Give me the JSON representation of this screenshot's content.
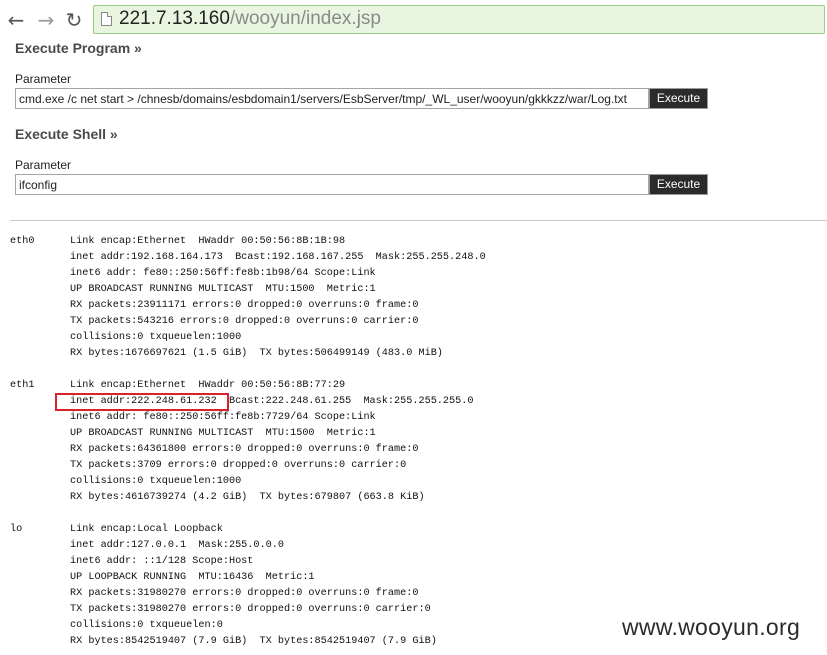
{
  "browser": {
    "back_icon": "←",
    "forward_icon": "→",
    "reload_icon": "↻",
    "url_host": "221.7.13.160",
    "url_path": "/wooyun/index.jsp"
  },
  "execute_program": {
    "title": "Execute Program »",
    "param_label": "Parameter",
    "value": "cmd.exe /c net start > /chnesb/domains/esbdomain1/servers/EsbServer/tmp/_WL_user/wooyun/gkkkzz/war/Log.txt",
    "button_label": "Execute"
  },
  "execute_shell": {
    "title": "Execute Shell »",
    "param_label": "Parameter",
    "value": "ifconfig",
    "button_label": "Execute"
  },
  "output": {
    "interfaces": [
      {
        "name": "eth0",
        "lines": [
          "Link encap:Ethernet  HWaddr 00:50:56:8B:1B:98",
          "inet addr:192.168.164.173  Bcast:192.168.167.255  Mask:255.255.248.0",
          "inet6 addr: fe80::250:56ff:fe8b:1b98/64 Scope:Link",
          "UP BROADCAST RUNNING MULTICAST  MTU:1500  Metric:1",
          "RX packets:23911171 errors:0 dropped:0 overruns:0 frame:0",
          "TX packets:543216 errors:0 dropped:0 overruns:0 carrier:0",
          "collisions:0 txqueuelen:1000",
          "RX bytes:1676697621 (1.5 GiB)  TX bytes:506499149 (483.0 MiB)"
        ]
      },
      {
        "name": "eth1",
        "lines": [
          "Link encap:Ethernet  HWaddr 00:50:56:8B:77:29",
          "inet addr:222.248.61.232  Bcast:222.248.61.255  Mask:255.255.255.0",
          "inet6 addr: fe80::250:56ff:fe8b:7729/64 Scope:Link",
          "UP BROADCAST RUNNING MULTICAST  MTU:1500  Metric:1",
          "RX packets:64361800 errors:0 dropped:0 overruns:0 frame:0",
          "TX packets:3709 errors:0 dropped:0 overruns:0 carrier:0",
          "collisions:0 txqueuelen:1000",
          "RX bytes:4616739274 (4.2 GiB)  TX bytes:679807 (663.8 KiB)"
        ]
      },
      {
        "name": "lo",
        "lines": [
          "Link encap:Local Loopback",
          "inet addr:127.0.0.1  Mask:255.0.0.0",
          "inet6 addr: ::1/128 Scope:Host",
          "UP LOOPBACK RUNNING  MTU:16436  Metric:1",
          "RX packets:31980270 errors:0 dropped:0 overruns:0 frame:0",
          "TX packets:31980270 errors:0 dropped:0 overruns:0 carrier:0",
          "collisions:0 txqueuelen:0",
          "RX bytes:8542519407 (7.9 GiB)  TX bytes:8542519407 (7.9 GiB)"
        ]
      }
    ]
  },
  "watermark": "www.wooyun.org",
  "colors": {
    "highlight_box": "#d9232a",
    "omnibox_bg": "#e8f5e0",
    "button_bg": "#2b2b2b"
  }
}
